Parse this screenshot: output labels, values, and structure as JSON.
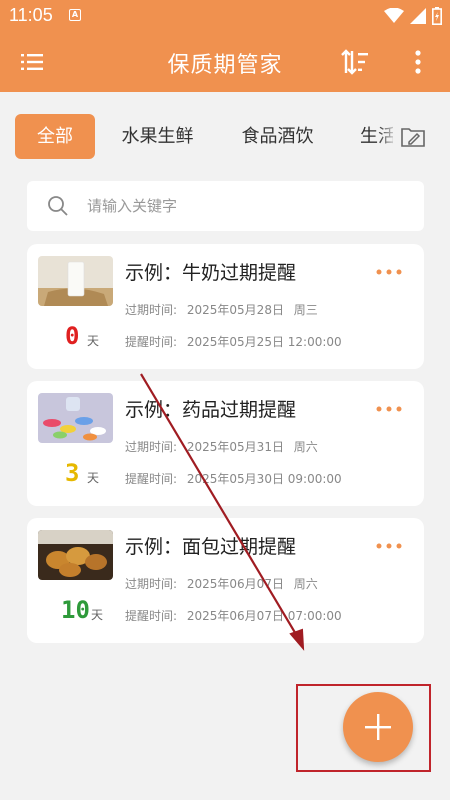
{
  "status_bar": {
    "time": "11:05",
    "notification_badge": "A"
  },
  "app_bar": {
    "title": "保质期管家",
    "color": "#f0914f"
  },
  "tabs": [
    {
      "label": "全部",
      "active": true
    },
    {
      "label": "水果生鲜",
      "active": false
    },
    {
      "label": "食品酒饮",
      "active": false
    },
    {
      "label": "生活",
      "active": false
    }
  ],
  "search": {
    "placeholder": "请输入关键字",
    "value": ""
  },
  "items": [
    {
      "title": "示例：牛奶过期提醒",
      "expiry_label": "过期时间:",
      "expiry_date": "2025年05月28日",
      "expiry_weekday": "周三",
      "remind_label": "提醒时间:",
      "remind_datetime": "2025年05月25日 12:00:00",
      "days_left": "0",
      "days_unit": "天",
      "days_color": "#e02020",
      "image": "milk"
    },
    {
      "title": "示例：药品过期提醒",
      "expiry_label": "过期时间:",
      "expiry_date": "2025年05月31日",
      "expiry_weekday": "周六",
      "remind_label": "提醒时间:",
      "remind_datetime": "2025年05月30日 09:00:00",
      "days_left": "3",
      "days_unit": "天",
      "days_color": "#e6b800",
      "image": "pills"
    },
    {
      "title": "示例：面包过期提醒",
      "expiry_label": "过期时间:",
      "expiry_date": "2025年06月07日",
      "expiry_weekday": "周六",
      "remind_label": "提醒时间:",
      "remind_datetime": "2025年06月07日 07:00:00",
      "days_left": "10",
      "days_unit": "天",
      "days_color": "#2e9a3a",
      "image": "bread"
    }
  ],
  "fab": {
    "icon": "plus-icon"
  },
  "annotation": {
    "arrow_color": "#a01c22",
    "highlight_color": "#c0242b"
  }
}
